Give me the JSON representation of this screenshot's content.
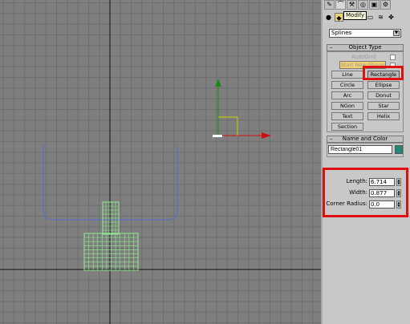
{
  "tooltip": "Modify",
  "tabs": [
    {
      "icon": "create-icon"
    },
    {
      "icon": "modify-icon"
    },
    {
      "icon": "hierarchy-icon"
    },
    {
      "icon": "motion-icon"
    },
    {
      "icon": "display-icon"
    },
    {
      "icon": "utilities-icon"
    }
  ],
  "category_dropdown": {
    "value": "Splines"
  },
  "object_type": {
    "title": "Object Type",
    "autogrid_label": "AutoGrid",
    "start_new_shape_label": "Start New Shape",
    "buttons": [
      "Line",
      "Rectangle",
      "Circle",
      "Ellipse",
      "Arc",
      "Donut",
      "NGon",
      "Star",
      "Text",
      "Helix",
      "Section"
    ]
  },
  "name_and_color": {
    "title": "Name and Color",
    "name": "Rectangle01",
    "color": "#1a8a7a"
  },
  "parameters": {
    "length_label": "Length:",
    "length_value": "6.714",
    "width_label": "Width:",
    "width_value": "0.877",
    "corner_radius_label": "Corner Radius:",
    "corner_radius_value": "0.0"
  },
  "colors": {
    "viewport_bg": "#7f7f7f",
    "grid": "#6e6e6e",
    "axis": "#111111",
    "highlight": "#e01010",
    "wire_selected": "#90ee90",
    "spline": "#5a6fc0"
  }
}
